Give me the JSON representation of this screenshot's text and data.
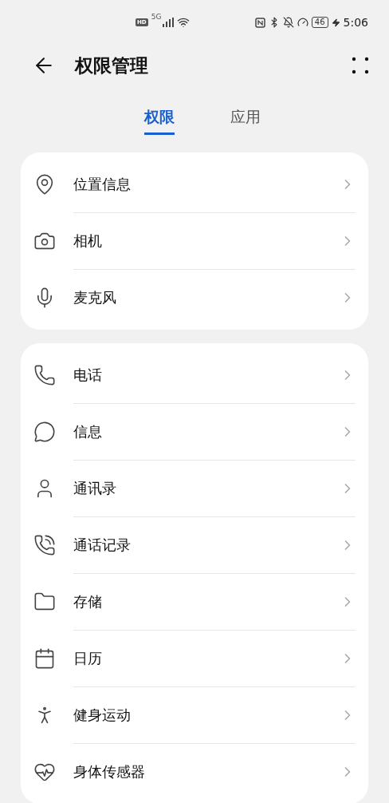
{
  "status_bar": {
    "hd_badge": "HD",
    "network_type": "5G",
    "battery": "46",
    "time": "5:06"
  },
  "header": {
    "title": "权限管理"
  },
  "tabs": [
    {
      "label": "权限",
      "selected": true
    },
    {
      "label": "应用",
      "selected": false
    }
  ],
  "groups": [
    {
      "items": [
        {
          "kind": "location",
          "label": "位置信息"
        },
        {
          "kind": "camera",
          "label": "相机"
        },
        {
          "kind": "mic",
          "label": "麦克风"
        }
      ]
    },
    {
      "items": [
        {
          "kind": "phone",
          "label": "电话"
        },
        {
          "kind": "message",
          "label": "信息"
        },
        {
          "kind": "contacts",
          "label": "通讯录"
        },
        {
          "kind": "call-log",
          "label": "通话记录"
        },
        {
          "kind": "folder",
          "label": "存储"
        },
        {
          "kind": "calendar",
          "label": "日历"
        },
        {
          "kind": "run",
          "label": "健身运动"
        },
        {
          "kind": "heart",
          "label": "身体传感器"
        }
      ]
    }
  ]
}
